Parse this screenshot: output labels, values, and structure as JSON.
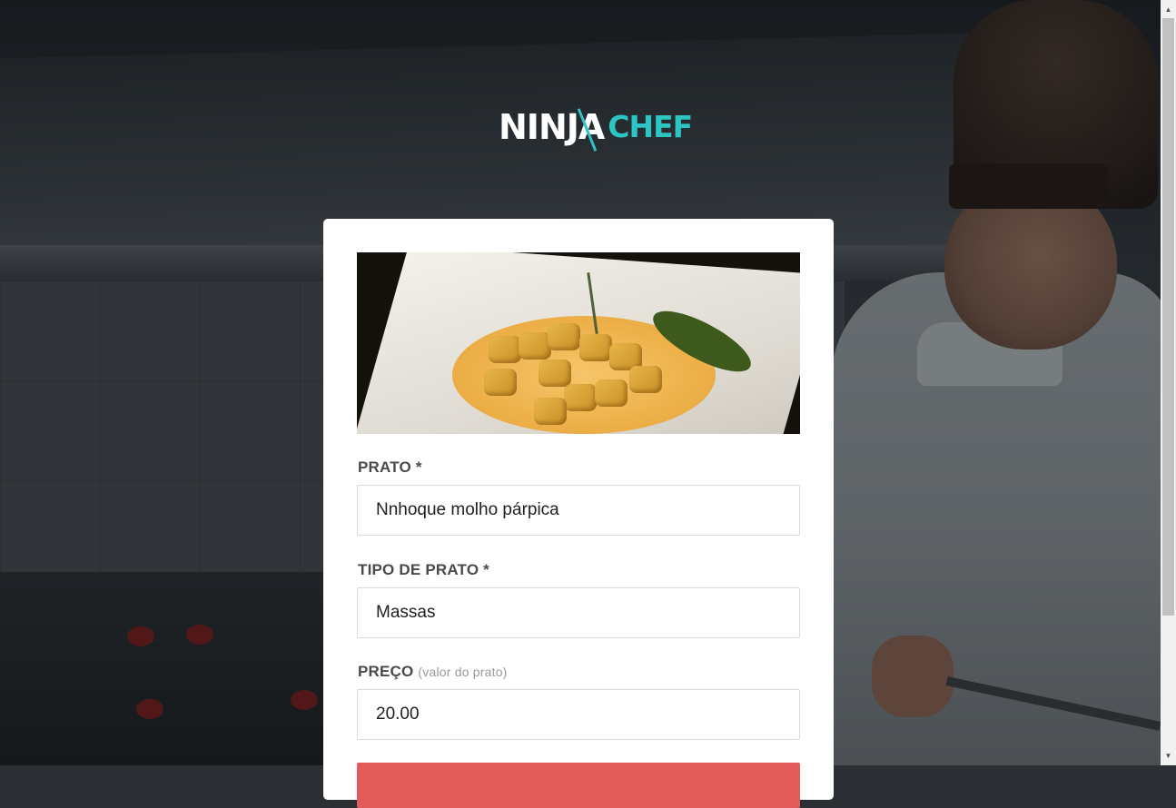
{
  "logo": {
    "part1": "NINJA",
    "part2": "CHEF"
  },
  "form": {
    "dish_image_alt": "dish-photo",
    "name_label": "PRATO *",
    "name_value": "Nnhoque molho párpica",
    "type_label": "TIPO DE PRATO *",
    "type_value": "Massas",
    "price_label": "PREÇO",
    "price_hint": "(valor do prato)",
    "price_value": "20.00"
  },
  "colors": {
    "accent": "#2ec4c4",
    "submit": "#e25a5a"
  },
  "icons": {
    "scroll_up": "scroll-up-arrow-icon",
    "scroll_down": "scroll-down-arrow-icon"
  }
}
